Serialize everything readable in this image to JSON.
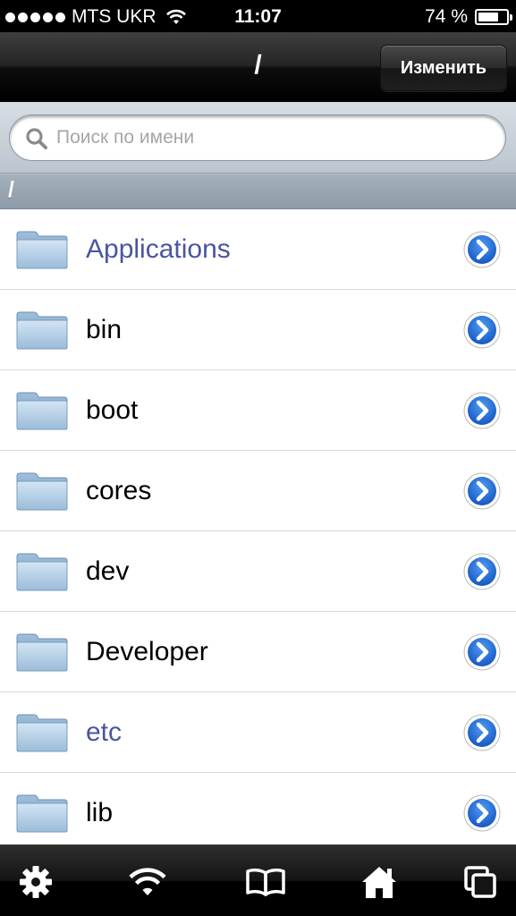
{
  "status_bar": {
    "carrier": "MTS UKR",
    "time": "11:07",
    "battery": "74 %",
    "battery_level": 0.74
  },
  "nav": {
    "title": "/",
    "edit_label": "Изменить"
  },
  "search": {
    "placeholder": "Поиск по имени",
    "value": ""
  },
  "path": "/",
  "items": [
    {
      "label": "Applications",
      "highlight": true
    },
    {
      "label": "bin",
      "highlight": false
    },
    {
      "label": "boot",
      "highlight": false
    },
    {
      "label": "cores",
      "highlight": false
    },
    {
      "label": "dev",
      "highlight": false
    },
    {
      "label": "Developer",
      "highlight": false
    },
    {
      "label": "etc",
      "highlight": true
    },
    {
      "label": "lib",
      "highlight": false
    }
  ],
  "tabs": [
    {
      "icon": "gear-icon"
    },
    {
      "icon": "wifi-icon"
    },
    {
      "icon": "book-icon"
    },
    {
      "icon": "home-icon"
    },
    {
      "icon": "windows-icon"
    }
  ],
  "colors": {
    "highlight_text": "#4a55a0",
    "disclosure_blue": "#1f6fd4"
  }
}
